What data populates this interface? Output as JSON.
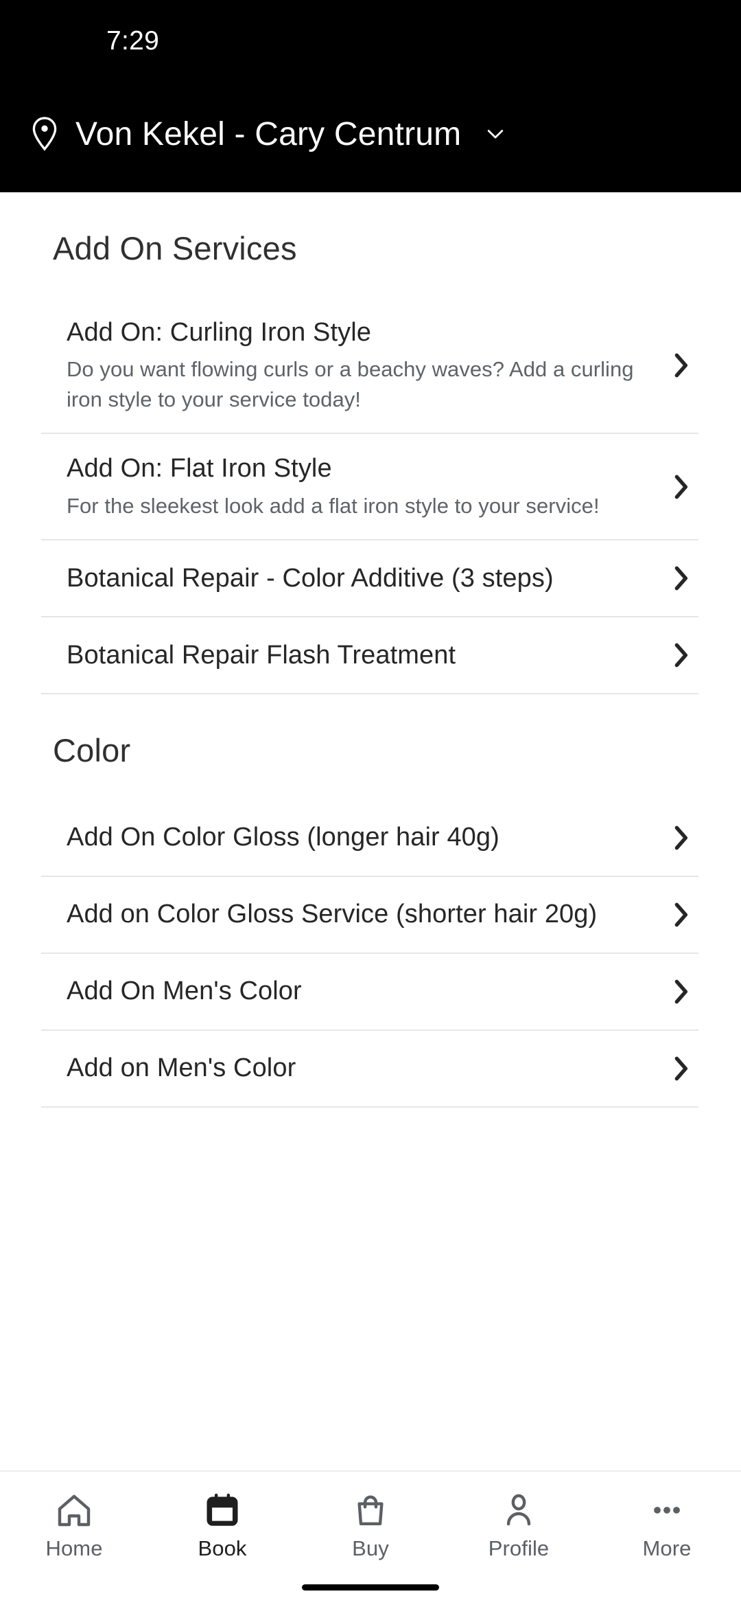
{
  "status_bar": {
    "time": "7:29"
  },
  "header": {
    "location_icon": "map-pin-icon",
    "location_name": "Von Kekel - Cary Centrum",
    "dropdown_icon": "chevron-down-icon"
  },
  "sections": [
    {
      "heading": "Add On Services",
      "items": [
        {
          "title": "Add On: Curling Iron Style",
          "description": "Do you want flowing curls or a beachy waves? Add a curling iron style to your service today!",
          "chevron": "chevron-right-icon"
        },
        {
          "title": "Add On: Flat Iron Style",
          "description": "For the sleekest look add a flat iron style to your service!",
          "chevron": "chevron-right-icon"
        },
        {
          "title": "Botanical Repair - Color Additive (3 steps)",
          "description": "",
          "chevron": "chevron-right-icon"
        },
        {
          "title": "Botanical Repair Flash Treatment",
          "description": "",
          "chevron": "chevron-right-icon"
        }
      ]
    },
    {
      "heading": "Color",
      "items": [
        {
          "title": "Add On Color Gloss (longer hair 40g)",
          "description": "",
          "chevron": "chevron-right-icon"
        },
        {
          "title": "Add on Color Gloss Service (shorter hair 20g)",
          "description": "",
          "chevron": "chevron-right-icon"
        },
        {
          "title": "Add On Men's Color",
          "description": "",
          "chevron": "chevron-right-icon"
        },
        {
          "title": "Add on Men's Color",
          "description": "",
          "chevron": "chevron-right-icon"
        }
      ]
    }
  ],
  "bottom_nav": {
    "items": [
      {
        "label": "Home",
        "icon": "home-icon",
        "active": false
      },
      {
        "label": "Book",
        "icon": "calendar-icon",
        "active": true
      },
      {
        "label": "Buy",
        "icon": "shopping-bag-icon",
        "active": false
      },
      {
        "label": "Profile",
        "icon": "person-icon",
        "active": false
      },
      {
        "label": "More",
        "icon": "ellipsis-icon",
        "active": false
      }
    ]
  },
  "colors": {
    "topbar_background": "#000000",
    "page_background": "#ffffff",
    "primary_text": "#262626",
    "secondary_text": "#5f6368",
    "divider": "#e6e6e6",
    "nav_inactive": "#5c5f63",
    "nav_active": "#1f1f1f"
  }
}
